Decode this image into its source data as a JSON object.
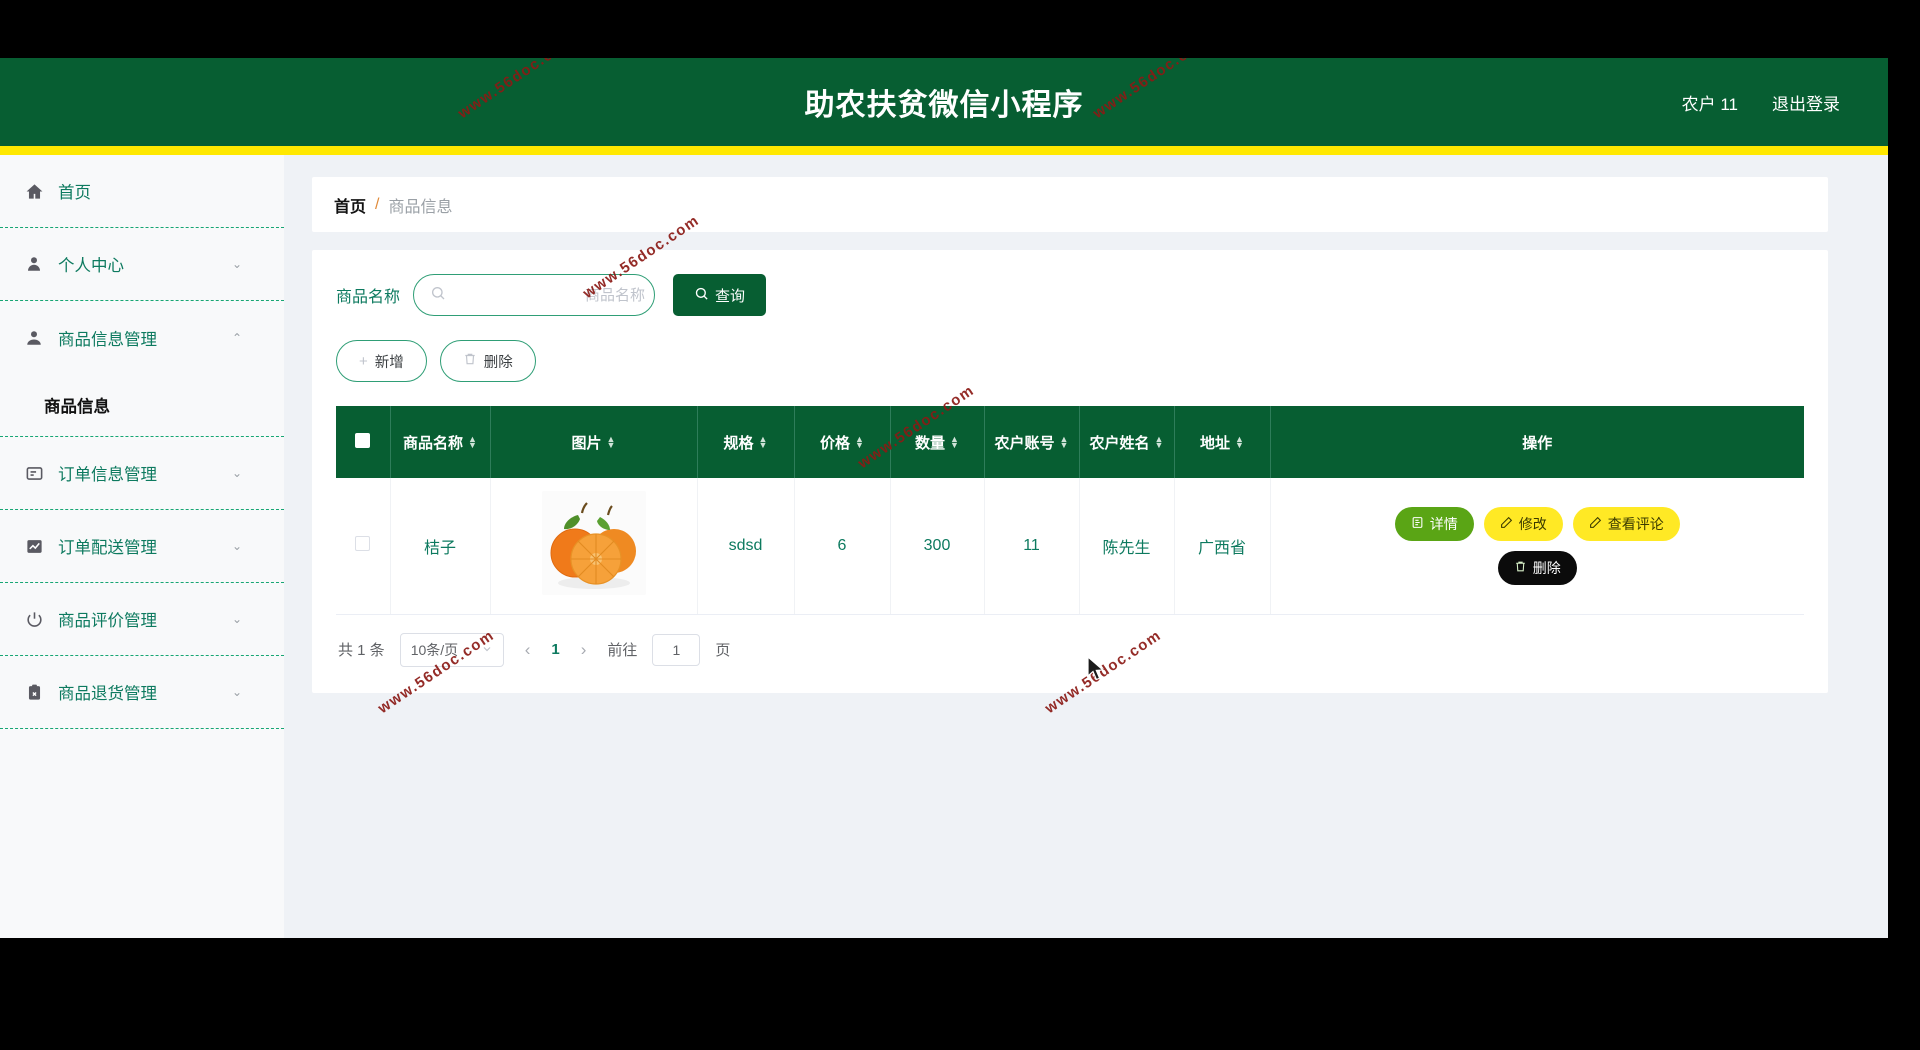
{
  "header": {
    "title": "助农扶贫微信小程序",
    "user": "农户 11",
    "logout": "退出登录"
  },
  "sidebar": {
    "items": [
      {
        "label": "首页",
        "icon": "home-icon",
        "arrow": ""
      },
      {
        "label": "个人中心",
        "icon": "user-icon",
        "arrow": "⌄"
      },
      {
        "label": "商品信息管理",
        "icon": "user-filled-icon",
        "arrow": "⌃"
      },
      {
        "label": "订单信息管理",
        "icon": "message-icon",
        "arrow": "⌄"
      },
      {
        "label": "订单配送管理",
        "icon": "chart-icon",
        "arrow": "⌄"
      },
      {
        "label": "商品评价管理",
        "icon": "power-icon",
        "arrow": "⌄"
      },
      {
        "label": "商品退货管理",
        "icon": "clipboard-icon",
        "arrow": "⌄"
      }
    ],
    "submenu": [
      {
        "label": "商品信息"
      }
    ]
  },
  "breadcrumb": {
    "home": "首页",
    "separator": "/",
    "current": "商品信息"
  },
  "search": {
    "label": "商品名称",
    "placeholder": "商品名称",
    "value": "",
    "button": "查询",
    "button_icon": "search-icon"
  },
  "toolbar": {
    "add_label": "新增",
    "add_icon": "plus-icon",
    "delete_label": "删除",
    "delete_icon": "trash-icon"
  },
  "table": {
    "columns": [
      {
        "key": "checkbox",
        "label": "",
        "sortable": false
      },
      {
        "key": "name",
        "label": "商品名称",
        "sortable": true
      },
      {
        "key": "image",
        "label": "图片",
        "sortable": true
      },
      {
        "key": "spec",
        "label": "规格",
        "sortable": true
      },
      {
        "key": "price",
        "label": "价格",
        "sortable": true
      },
      {
        "key": "quantity",
        "label": "数量",
        "sortable": true
      },
      {
        "key": "account",
        "label": "农户账号",
        "sortable": true
      },
      {
        "key": "farmer",
        "label": "农户姓名",
        "sortable": true
      },
      {
        "key": "address",
        "label": "地址",
        "sortable": true
      },
      {
        "key": "operation",
        "label": "操作",
        "sortable": false
      }
    ],
    "rows": [
      {
        "name": "桔子",
        "image_alt": "orange-thumbnail",
        "spec": "sdsd",
        "price": "6",
        "quantity": "300",
        "account": "11",
        "farmer": "陈先生",
        "address": "广西省",
        "operations": [
          {
            "label": "详情",
            "icon": "detail-icon",
            "style": "detail"
          },
          {
            "label": "修改",
            "icon": "edit-icon",
            "style": "edit"
          },
          {
            "label": "查看评论",
            "icon": "edit-icon",
            "style": "comment"
          },
          {
            "label": "删除",
            "icon": "trash-icon",
            "style": "delete"
          }
        ]
      }
    ]
  },
  "pagination": {
    "total_text": "共 1 条",
    "page_size": "10条/页",
    "prev_icon": "chevron-left-icon",
    "next_icon": "chevron-right-icon",
    "current_page": "1",
    "jump_label": "前往",
    "jump_value": "1",
    "page_unit": "页"
  },
  "watermark": {
    "text": "www.56doc.com",
    "color": "#8b1a15"
  },
  "colors": {
    "brand_green": "#075e32",
    "accent_yellow": "#ffe800",
    "link_green": "#0d7a5f",
    "detail_green": "#5aa515",
    "btn_yellow": "#ffe925",
    "btn_black": "#0b0b0b",
    "page_bg": "#eff2f6"
  }
}
